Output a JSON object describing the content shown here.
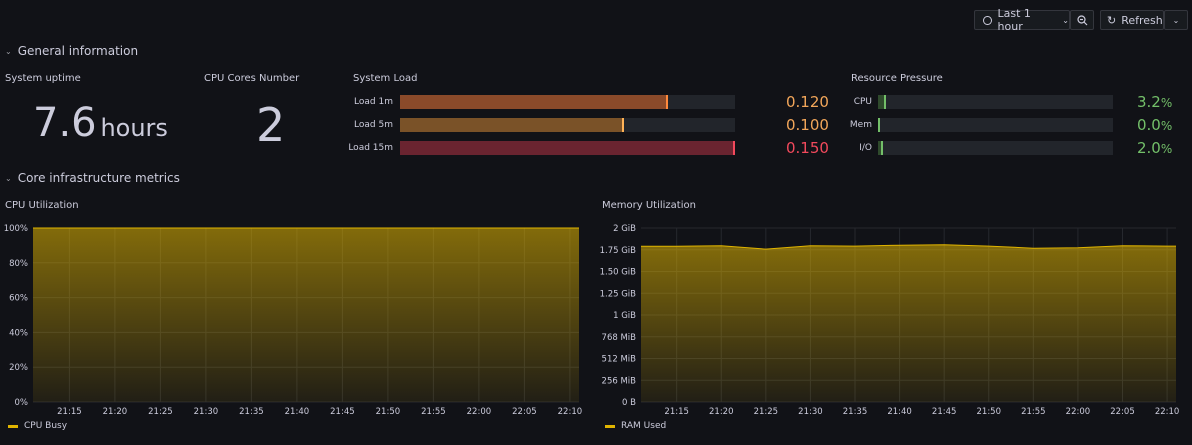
{
  "toolbar": {
    "time_range_label": "Last 1 hour",
    "refresh_label": "Refresh"
  },
  "rows": {
    "general": "General information",
    "core": "Core infrastructure metrics"
  },
  "uptime": {
    "title": "System uptime",
    "value": "7.6",
    "unit": "hours"
  },
  "cores": {
    "title": "CPU Cores Number",
    "value": "2"
  },
  "load": {
    "title": "System Load",
    "items": [
      {
        "label": "Load 1m",
        "value": "0.120",
        "fraction": 0.8,
        "color": "#8a4a2a",
        "cap": "#ff8a3d",
        "text_color": "#f2a65a"
      },
      {
        "label": "Load 5m",
        "value": "0.100",
        "fraction": 0.67,
        "color": "#7a5228",
        "cap": "#ffb357",
        "text_color": "#f2a65a"
      },
      {
        "label": "Load 15m",
        "value": "0.150",
        "fraction": 1.0,
        "color": "#6a2430",
        "cap": "#f2495c",
        "text_color": "#f2495c"
      }
    ]
  },
  "pressure": {
    "title": "Resource Pressure",
    "items": [
      {
        "label": "CPU",
        "value": "3.2",
        "unit": "%",
        "fraction": 0.032
      },
      {
        "label": "Mem",
        "value": "0.0",
        "unit": "%",
        "fraction": 0.0
      },
      {
        "label": "I/O",
        "value": "2.0",
        "unit": "%",
        "fraction": 0.02
      }
    ],
    "color": "#73bf69"
  },
  "cpu_panel": {
    "title": "CPU Utilization",
    "legend": "CPU Busy",
    "color": "#e0b400"
  },
  "mem_panel": {
    "title": "Memory Utilization",
    "legend": "RAM Used",
    "color": "#e0b400"
  },
  "chart_data": [
    {
      "type": "area",
      "title": "CPU Utilization",
      "x": [
        "21:15",
        "21:20",
        "21:25",
        "21:30",
        "21:35",
        "21:40",
        "21:45",
        "21:50",
        "21:55",
        "22:00",
        "22:05",
        "22:10"
      ],
      "yticks": [
        "0%",
        "20%",
        "40%",
        "60%",
        "80%",
        "100%"
      ],
      "ylim": [
        0,
        100
      ],
      "series": [
        {
          "name": "CPU Busy",
          "values": [
            100,
            100,
            100,
            100,
            100,
            100,
            100,
            100,
            100,
            100,
            100,
            100
          ]
        }
      ]
    },
    {
      "type": "area",
      "title": "Memory Utilization",
      "x": [
        "21:15",
        "21:20",
        "21:25",
        "21:30",
        "21:35",
        "21:40",
        "21:45",
        "21:50",
        "21:55",
        "22:00",
        "22:05",
        "22:10"
      ],
      "yticks": [
        "0 B",
        "256 MiB",
        "512 MiB",
        "768 MiB",
        "1 GiB",
        "1.25 GiB",
        "1.50 GiB",
        "1.75 GiB",
        "2 GiB"
      ],
      "ylim": [
        0,
        2048
      ],
      "series": [
        {
          "name": "RAM Used",
          "values": [
            1833,
            1838,
            1800,
            1840,
            1835,
            1845,
            1850,
            1835,
            1810,
            1815,
            1840,
            1835
          ]
        }
      ]
    }
  ]
}
